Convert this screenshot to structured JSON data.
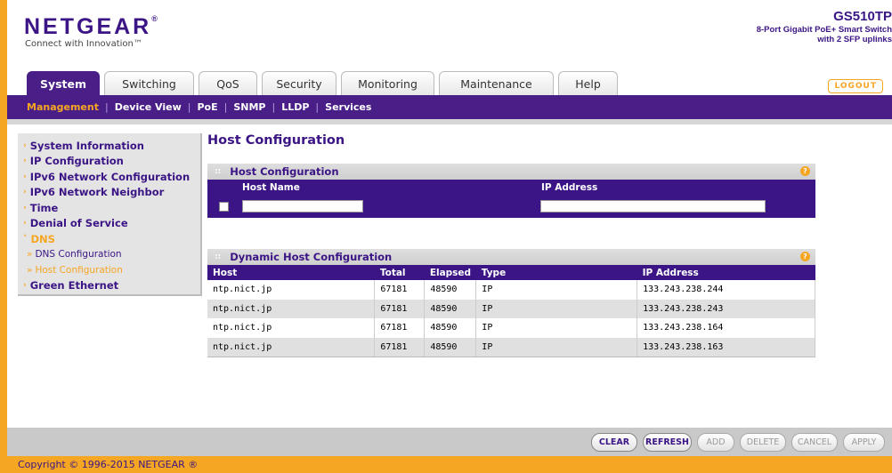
{
  "header": {
    "brand": "NETGEAR",
    "brand_mark": "®",
    "tagline": "Connect with Innovation™",
    "model": "GS510TP",
    "model_desc_1": "8-Port Gigabit PoE+ Smart Switch",
    "model_desc_2": "with 2 SFP uplinks",
    "logout": "LOGOUT"
  },
  "tabs": [
    "System",
    "Switching",
    "QoS",
    "Security",
    "Monitoring",
    "Maintenance",
    "Help"
  ],
  "subnav": [
    "Management",
    "Device View",
    "PoE",
    "SNMP",
    "LLDP",
    "Services"
  ],
  "sidebar": {
    "items": [
      "System Information",
      "IP Configuration",
      "IPv6 Network Configuration",
      "IPv6 Network Neighbor",
      "Time",
      "Denial of Service",
      "DNS",
      "Green Ethernet"
    ],
    "dns_sub": [
      "DNS Configuration",
      "Host Configuration"
    ]
  },
  "main": {
    "title": "Host Configuration",
    "host_panel": {
      "title": "Host Configuration",
      "col_host_name": "Host Name",
      "col_ip": "IP Address",
      "host_name_value": "",
      "ip_value": ""
    },
    "dyn_panel": {
      "title": "Dynamic Host Configuration",
      "columns": [
        "Host",
        "Total",
        "Elapsed",
        "Type",
        "IP Address"
      ],
      "rows": [
        [
          "ntp.nict.jp",
          "67181",
          "48590",
          "IP",
          "133.243.238.244"
        ],
        [
          "ntp.nict.jp",
          "67181",
          "48590",
          "IP",
          "133.243.238.243"
        ],
        [
          "ntp.nict.jp",
          "67181",
          "48590",
          "IP",
          "133.243.238.164"
        ],
        [
          "ntp.nict.jp",
          "67181",
          "48590",
          "IP",
          "133.243.238.163"
        ]
      ]
    },
    "help_glyph": "?"
  },
  "buttons": [
    "CLEAR",
    "REFRESH",
    "ADD",
    "DELETE",
    "CANCEL",
    "APPLY"
  ],
  "footer": "Copyright © 1996-2015 NETGEAR ®",
  "colors": {
    "brand_purple": "#3b1585",
    "nav_purple": "#4a1e87",
    "accent_orange": "#f5a623"
  }
}
